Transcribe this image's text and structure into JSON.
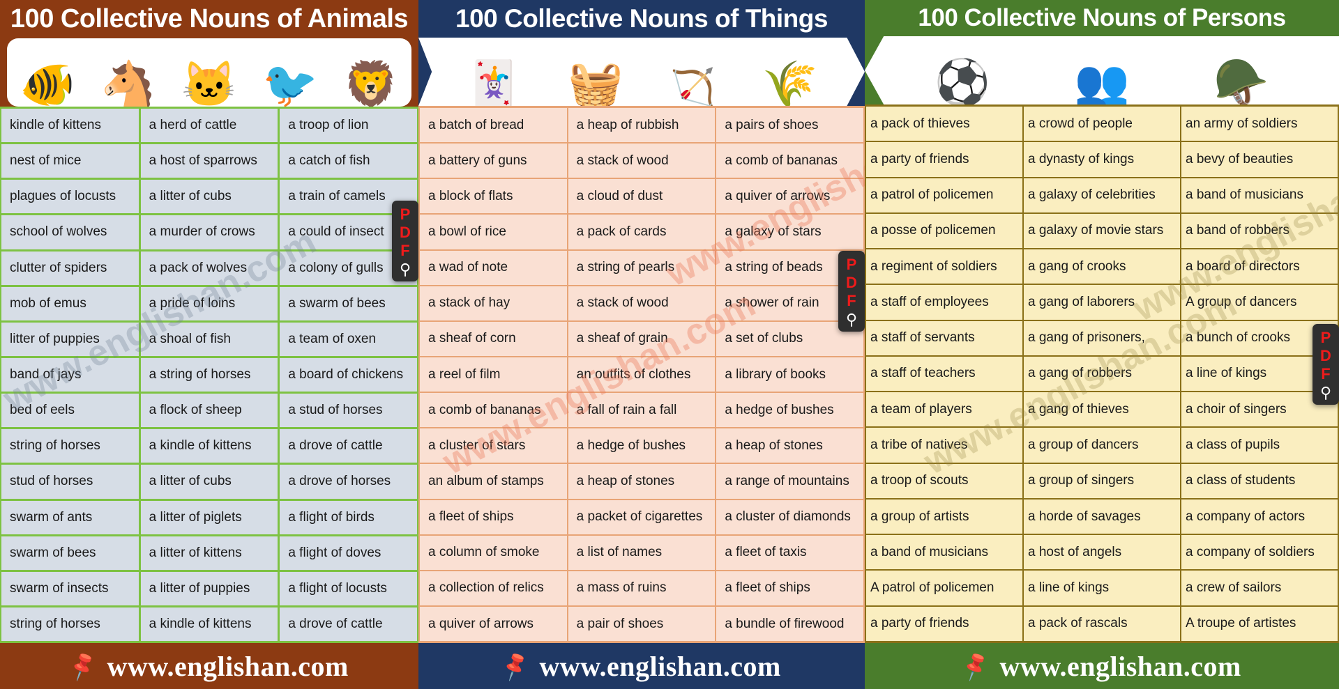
{
  "panels": [
    {
      "id": "animals",
      "title": "100 Collective Nouns of Animals",
      "accent": "#8c3a12",
      "grid_color": "#7dc242",
      "cell_color": "#d6dde6",
      "hero_icons": [
        "fish",
        "horse",
        "cat-and-dog",
        "bird",
        "lion"
      ],
      "watermark": "www.englishan.com",
      "footer_url": "www.englishan.com",
      "columns": [
        [
          "kindle of kittens",
          "nest of mice",
          "plagues of locusts",
          "school of wolves",
          "clutter of spiders",
          "mob of emus",
          "litter of puppies",
          "band of jays",
          "bed of eels",
          "string of horses",
          "stud of horses",
          "swarm of ants",
          "swarm of bees",
          "swarm of insects",
          "string of horses"
        ],
        [
          "a herd of cattle",
          "a host of sparrows",
          "a litter of cubs",
          "a murder of crows",
          "a pack of wolves",
          "a pride of loins",
          "a shoal of fish",
          "a string of horses",
          "a flock of sheep",
          "a kindle of kittens",
          "a litter of cubs",
          "a litter of piglets",
          "a litter of kittens",
          "a litter of puppies",
          "a kindle of kittens"
        ],
        [
          "a troop of lion",
          "a catch of fish",
          "a train of camels",
          "a could of insect",
          "a colony of gulls",
          "a swarm of bees",
          "a team of oxen",
          "a board of chickens",
          "a stud of horses",
          "a drove of cattle",
          "a drove of horses",
          "a flight of birds",
          "a flight of doves",
          "a flight of locusts",
          "a drove of cattle"
        ]
      ]
    },
    {
      "id": "things",
      "title": "100  Collective Nouns of Things",
      "accent": "#1f3864",
      "grid_color": "#e8a476",
      "cell_color": "#fae0d3",
      "hero_icons": [
        "playing-cards",
        "fruit-basket",
        "quiver-of-arrows",
        "sheaf-of-grain"
      ],
      "watermark": "www.englishan.com",
      "footer_url": "www.englishan.com",
      "columns": [
        [
          "a batch of bread",
          "a battery of guns",
          "a block of flats",
          "a bowl of rice",
          "a wad of note",
          "a stack of hay",
          "a sheaf of corn",
          "a reel of film",
          "a comb of bananas",
          "a cluster of stars",
          "an album of stamps",
          "a fleet of ships",
          "a column of smoke",
          "a collection of relics",
          "a quiver of arrows"
        ],
        [
          "a heap of rubbish",
          "a stack of wood",
          "a cloud of dust",
          "a pack of cards",
          "a string of pearls",
          "a stack of wood",
          "a sheaf of grain",
          "an outfits of clothes",
          "a fall of rain a fall",
          "a hedge of bushes",
          "a heap of stones",
          "a packet of cigarettes",
          "a list of names",
          "a mass of ruins",
          "a pair of shoes"
        ],
        [
          "a pairs of shoes",
          "a comb of bananas",
          "a quiver of arrows",
          "a galaxy of stars",
          "a string of beads",
          "a shower of rain",
          "a set of clubs",
          "a library of books",
          "a hedge of bushes",
          " a heap of stones",
          "a range of mountains",
          "a cluster of diamonds",
          "a fleet of taxis",
          "a fleet of ships",
          "a bundle of firewood"
        ]
      ]
    },
    {
      "id": "persons",
      "title": "100 Collective Nouns of Persons",
      "accent": "#4a7d2c",
      "grid_color": "#8a7018",
      "cell_color": "#faeec0",
      "hero_icons": [
        "football-team",
        "cheering-crowd",
        "soldiers"
      ],
      "watermark": "www.englishan.com",
      "footer_url": "www.englishan.com",
      "columns": [
        [
          "a pack of thieves",
          "a party of friends",
          "a patrol of policemen",
          "a posse of policemen",
          "a regiment of soldiers",
          "a staff of employees",
          "a staff of servants",
          "a staff of teachers",
          "a team of players",
          "a tribe of natives",
          "a troop of scouts",
          "a group of artists",
          "a band of musicians",
          "A patrol of policemen",
          "a party of friends"
        ],
        [
          "a crowd of people",
          "a dynasty of kings",
          "a galaxy of celebrities",
          "a galaxy of movie stars",
          "a gang of crooks",
          "a gang of laborers",
          "a gang of prisoners,",
          "a gang of robbers",
          "a gang of thieves",
          "a group of dancers",
          "a group of singers",
          "a horde of savages",
          "a host of angels",
          "a line of kings",
          "a pack of rascals"
        ],
        [
          "an army of soldiers",
          "a bevy of beauties",
          "a band of musicians",
          "a band of robbers",
          "a board of directors",
          "A group of dancers",
          "a bunch of crooks",
          "a line of kings",
          "a choir of singers",
          "a class of pupils",
          "a class of students",
          "a company of actors",
          "a company of soldiers",
          "a crew of sailors",
          "A troupe of artistes"
        ]
      ]
    }
  ],
  "pdf_widget": {
    "letters": [
      "P",
      "D",
      "F"
    ],
    "pin_icon": "pin-icon"
  }
}
